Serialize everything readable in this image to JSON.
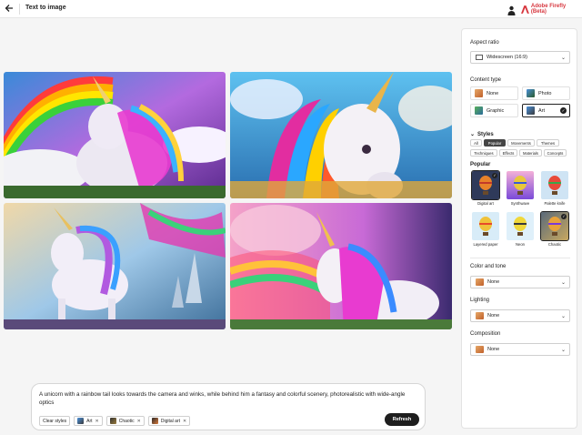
{
  "header": {
    "back_icon": "arrow-left-icon",
    "title": "Text to image",
    "brand": "Adobe Firefly (Beta)",
    "brand_color": "#d7373f"
  },
  "gallery": {
    "images": [
      {
        "name": "unicorn-rainbow-clouds"
      },
      {
        "name": "unicorn-blue-sky"
      },
      {
        "name": "unicorn-pastel-castle"
      },
      {
        "name": "unicorn-pink-sky"
      }
    ]
  },
  "prompt": {
    "text": "A unicorn with a rainbow tail looks towards the camera and winks, while behind him a fantasy and colorful scenery, photorealistic with wide-angle optics",
    "clear_label": "Clear styles",
    "chips": [
      {
        "label": "Art"
      },
      {
        "label": "Chaotic"
      },
      {
        "label": "Digital art"
      }
    ],
    "refresh_label": "Refresh"
  },
  "panel": {
    "aspect_ratio_label": "Aspect ratio",
    "aspect_ratio_value": "Widescreen (16:9)",
    "content_type_label": "Content type",
    "content_types": [
      {
        "label": "None"
      },
      {
        "label": "Photo"
      },
      {
        "label": "Graphic"
      },
      {
        "label": "Art",
        "selected": true
      }
    ],
    "styles_label": "Styles",
    "style_tabs_row1": [
      "All",
      "Popular",
      "Movements",
      "Themes"
    ],
    "style_tabs_row2": [
      "Techniques",
      "Effects",
      "Materials",
      "Concepts"
    ],
    "active_tab": "Popular",
    "popular_label": "Popular",
    "popular_styles": [
      {
        "label": "Digital art",
        "selected": true
      },
      {
        "label": "Synthwave"
      },
      {
        "label": "Palette knife"
      },
      {
        "label": "Layered paper"
      },
      {
        "label": "Neon"
      },
      {
        "label": "Chaotic",
        "selected": true
      }
    ],
    "color_tone_label": "Color and tone",
    "color_tone_value": "None",
    "lighting_label": "Lighting",
    "lighting_value": "None",
    "composition_label": "Composition",
    "composition_value": "None"
  }
}
